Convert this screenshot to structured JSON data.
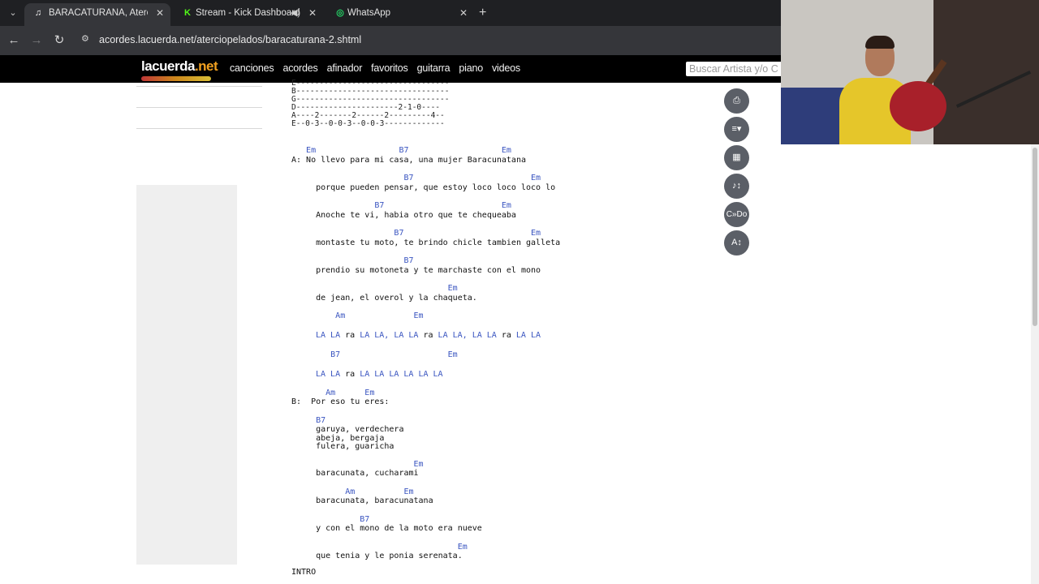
{
  "browser": {
    "tabs": [
      {
        "title": "BARACATURANA, Aterciopelad",
        "favicon": "music-note-favicon",
        "active": true
      },
      {
        "title": "Stream - Kick Dashboard",
        "favicon": "kick-favicon",
        "audio": true
      },
      {
        "title": "WhatsApp",
        "favicon": "whatsapp-favicon"
      }
    ],
    "url": "acordes.lacuerda.net/aterciopelados/baracaturana-2.shtml"
  },
  "site": {
    "logo": "lacuerda",
    "logo_tld": ".net",
    "menu": [
      "canciones",
      "acordes",
      "afinador",
      "favoritos",
      "guitarra",
      "piano",
      "videos"
    ],
    "search_placeholder": "Buscar Artista y/o C"
  },
  "song": {
    "tab": [
      "E---------------------------------",
      "B---------------------------------",
      "G---------------------------------",
      "D----------------------2-1-0----",
      "A----2-------2------2---------4--",
      "E--0-3--0-0-3--0-0-3-------------"
    ],
    "l1c": "   Em                 B7                   Em",
    "l1t": "A: No llevo para mi casa, una mujer Baracunatana",
    "l2c": "                       B7                        Em",
    "l2t": "     porque pueden pensar, que estoy loco loco loco lo",
    "l3c": "                 B7                        Em",
    "l3t": "     Anoche te vi, habia otro que te chequeaba",
    "l4c": "                     B7                          Em",
    "l4t": "     montaste tu moto, te brindo chicle tambien galleta",
    "l5c": "                       B7",
    "l5t": "     prendio su motoneta y te marchaste con el mono",
    "l6c": "                                Em",
    "l6t": "     de jean, el overol y la chaqueta.",
    "c1c": "         Am              Em",
    "c1a": "LA LA",
    "c1b": " ra ",
    "c1c2": "LA LA, LA LA",
    "c1d": " ra ",
    "c1e": "LA LA, LA LA",
    "c1f": " ra ",
    "c1g": "LA LA",
    "c2c": "        B7                      Em",
    "c2a": "LA LA",
    "c2b": " ra ",
    "c2c2": "LA LA LA LA LA LA",
    "b0c": "       Am      Em",
    "b0t": "B:  Por eso tu eres:",
    "b1c": "     B7",
    "b1t1": "     garuya, verdechera",
    "b1t2": "     abeja, bergaja",
    "b1t3": "     fulera, guaricha",
    "b2c": "                         Em",
    "b2t": "     baracunata, cucharami",
    "b3c": "           Am          Em",
    "b3t": "     baracunata, baracunatana",
    "b4c": "              B7",
    "b4t": "     y con el mono de la moto era nueve",
    "b5c": "                                  Em",
    "b5t": "     que tenia y le ponia serenata.",
    "end": "INTRO"
  },
  "tools": [
    {
      "name": "print-icon",
      "glyph": "⎙"
    },
    {
      "name": "autoscroll-icon",
      "glyph": "≡▾"
    },
    {
      "name": "chord-diagram-icon",
      "glyph": "▦"
    },
    {
      "name": "transpose-icon",
      "glyph": "♪↕"
    },
    {
      "name": "notation-icon",
      "glyph": "C»Do"
    },
    {
      "name": "font-size-icon",
      "glyph": "A↕"
    }
  ]
}
